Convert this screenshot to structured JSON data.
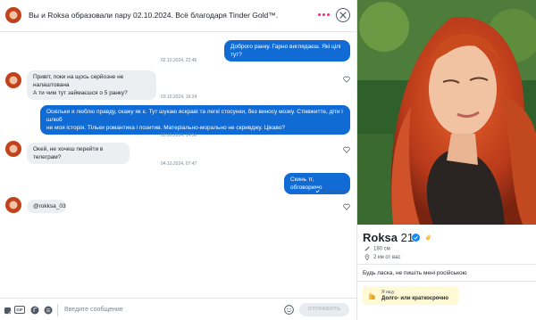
{
  "header": {
    "match_text": "Вы и Roksa образовали пару 02.10.2024. Всё благодаря Tinder Gold™."
  },
  "colors": {
    "accent": "#fd267a",
    "outgoing_bubble": "#106bd5",
    "incoming_bubble": "#eceff1",
    "gold_badge": "#fff9d6"
  },
  "messages": [
    {
      "id": "m1",
      "from": "me",
      "text": "Доброго ранку. Гарно виглядаєш. Які цілі тут?",
      "time": "02.10.2024, 22:46"
    },
    {
      "id": "m2",
      "from": "them",
      "lines": [
        "Привіт, поки на щось серйозне не налаштована",
        "А ти чим тут займаєшся о 5 ранку?"
      ],
      "time": "03.10.2024, 16:24"
    },
    {
      "id": "m3",
      "from": "me",
      "lines": [
        "Оскільки я люблю правду, скажу як є. Тут шукаю яскраві та легкі стосунки, без виносу мозку. Стіквжитте, діти і шлюб",
        "не моя історія. Тільки романтика і позитив. Матеріально-морально не скривджу. Цікаво?"
      ],
      "time": "03.10.2024, 14:56"
    },
    {
      "id": "m4",
      "from": "them",
      "text": "Окей, не хочеш перейти в телеграм?",
      "time": "04.10.2024, 07:47"
    },
    {
      "id": "m5",
      "from": "me",
      "text": "Скинь тг, обговоримо",
      "status": "Отправлено"
    },
    {
      "id": "m6",
      "from": "them",
      "text": "@rokksa_03"
    }
  ],
  "composer": {
    "gif_label": "GIF",
    "placeholder": "Введите сообщение",
    "send_label": "ОТПРАВИТЬ"
  },
  "profile": {
    "name": "Roksa",
    "age": "21",
    "height": "180 см",
    "distance": "2 км от вас",
    "bio": "Будь ласка, не пишіть мені російською",
    "looking_for_label": "Я ищу",
    "looking_for_value": "Долго- или краткосрочно"
  },
  "icons": {
    "header": [
      "avatar",
      "more-dots-icon",
      "close-icon"
    ],
    "composer": [
      "sticker-icon",
      "gif-icon",
      "music-icon",
      "spotify-icon",
      "emoji-icon"
    ],
    "profile": [
      "verified-badge-icon",
      "wave-hand-icon",
      "ruler-icon",
      "location-pin-icon",
      "looking-for-icon"
    ]
  }
}
